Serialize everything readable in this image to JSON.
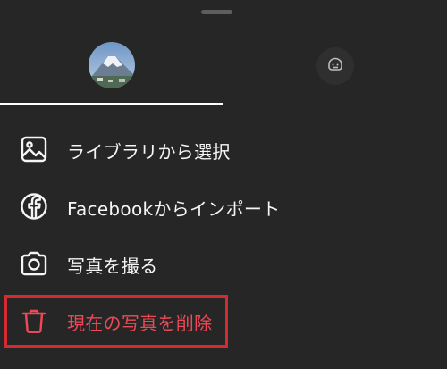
{
  "menu": {
    "items": [
      {
        "label": "ライブラリから選択",
        "icon": "image-icon"
      },
      {
        "label": "Facebookからインポート",
        "icon": "facebook-icon"
      },
      {
        "label": "写真を撮る",
        "icon": "camera-icon"
      },
      {
        "label": "現在の写真を削除",
        "icon": "trash-icon"
      }
    ]
  },
  "colors": {
    "background": "#262626",
    "text": "#f5f5f5",
    "danger": "#ed4956",
    "highlight": "#d32b30"
  }
}
